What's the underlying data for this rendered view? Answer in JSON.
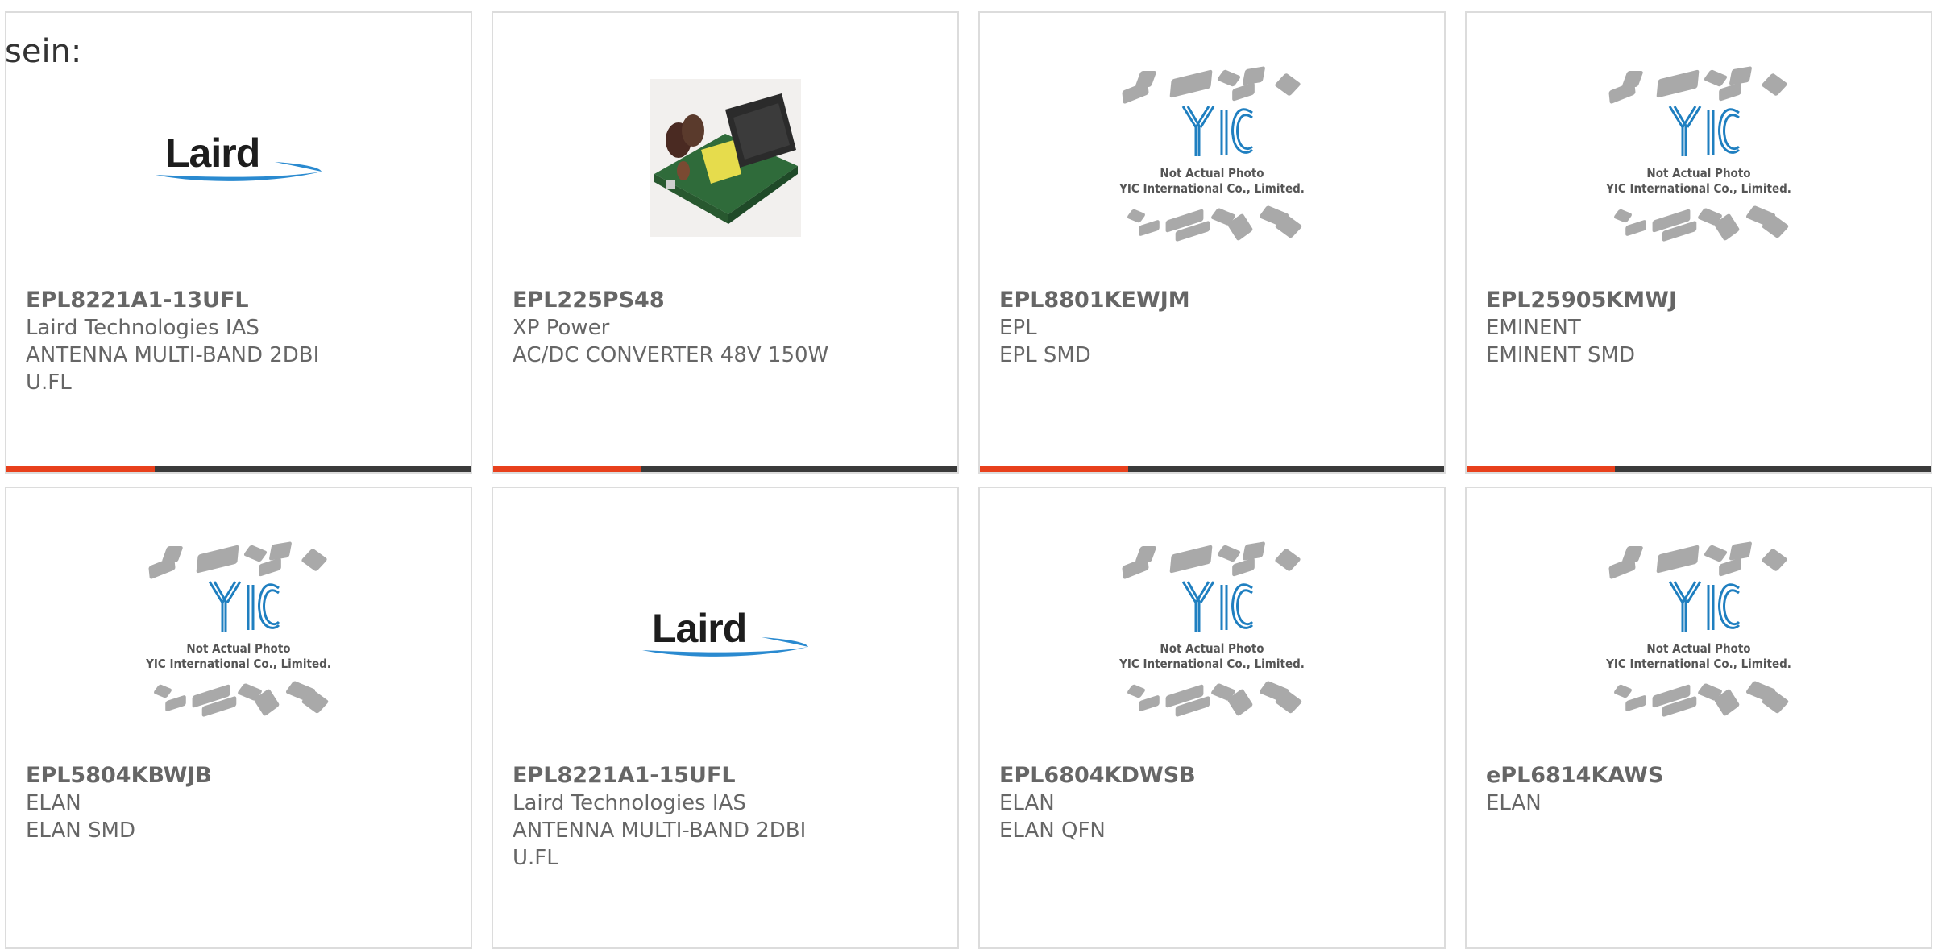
{
  "intro_text": "sein:",
  "placeholder_caption": {
    "line1": "Not Actual Photo",
    "line2": "YIC International Co., Limited."
  },
  "laird_logo_text": "Laird",
  "colors": {
    "accent": "#e8401c",
    "bar": "#3a3a3a",
    "text": "#666666",
    "yic_blue": "#1f7fc0"
  },
  "products": [
    {
      "part": "EPL8221A1-13UFL",
      "manufacturer": "Laird Technologies IAS",
      "desc1": "ANTENNA MULTI-BAND 2DBI",
      "desc2": "U.FL",
      "image": "laird-logo"
    },
    {
      "part": "EPL225PS48",
      "manufacturer": "XP Power",
      "desc1": "AC/DC CONVERTER 48V 150W",
      "desc2": "",
      "image": "psu-photo"
    },
    {
      "part": "EPL8801KEWJM",
      "manufacturer": "EPL",
      "desc1": "EPL SMD",
      "desc2": "",
      "image": "yic-placeholder"
    },
    {
      "part": "EPL25905KMWJ",
      "manufacturer": "EMINENT",
      "desc1": "EMINENT SMD",
      "desc2": "",
      "image": "yic-placeholder"
    },
    {
      "part": "EPL5804KBWJB",
      "manufacturer": "ELAN",
      "desc1": "ELAN SMD",
      "desc2": "",
      "image": "yic-placeholder"
    },
    {
      "part": "EPL8221A1-15UFL",
      "manufacturer": "Laird Technologies IAS",
      "desc1": "ANTENNA MULTI-BAND 2DBI",
      "desc2": "U.FL",
      "image": "laird-logo"
    },
    {
      "part": "EPL6804KDWSB",
      "manufacturer": "ELAN",
      "desc1": "ELAN QFN",
      "desc2": "",
      "image": "yic-placeholder"
    },
    {
      "part": "ePL6814KAWS",
      "manufacturer": "ELAN",
      "desc1": "",
      "desc2": "",
      "image": "yic-placeholder"
    }
  ]
}
